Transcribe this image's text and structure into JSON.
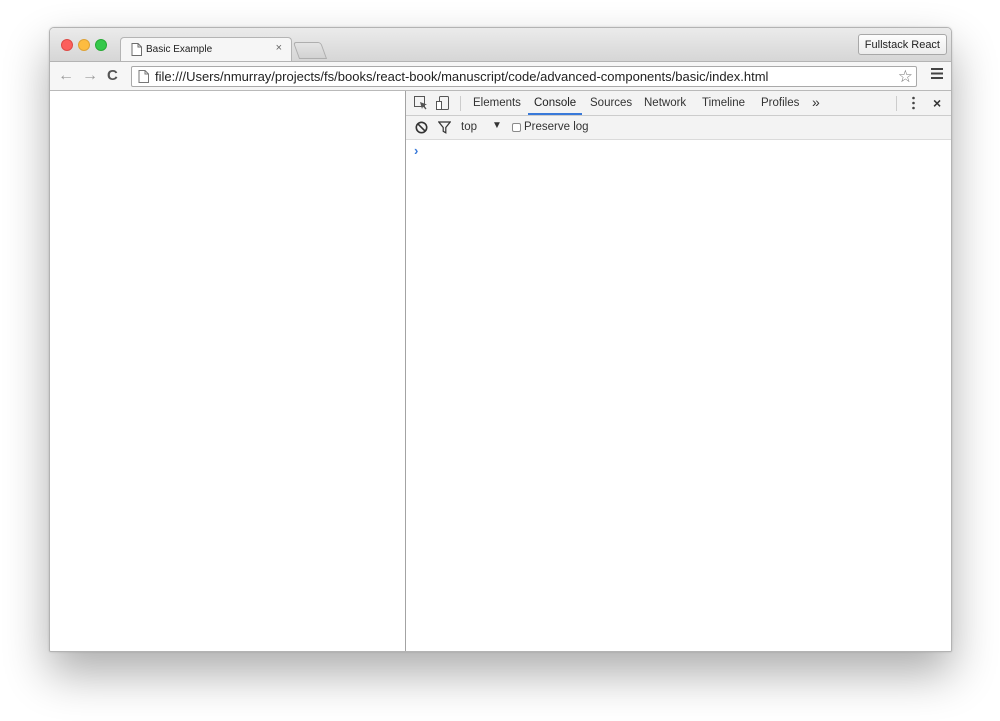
{
  "tab": {
    "title": "Basic Example",
    "close": "×"
  },
  "profile": {
    "label": "Fullstack React"
  },
  "toolbar": {
    "back": "←",
    "forward": "→",
    "reload": "C",
    "url": "file:///Users/nmurray/projects/fs/books/react-book/manuscript/code/advanced-components/basic/index.html",
    "star": "☆"
  },
  "devtools": {
    "tabs": [
      {
        "label": "Elements"
      },
      {
        "label": "Console"
      },
      {
        "label": "Sources"
      },
      {
        "label": "Network"
      },
      {
        "label": "Timeline"
      },
      {
        "label": "Profiles"
      }
    ],
    "active_tab": "Console",
    "more": "»",
    "close": "×",
    "console": {
      "context": "top",
      "context_caret": "▼",
      "preserve_log_label": "Preserve log",
      "preserve_log_checked": false,
      "prompt": "›"
    }
  },
  "icons": {
    "tab_page": "page-icon",
    "omnibox_page": "page-icon",
    "menu": "hamburger-menu-icon",
    "inspect": "inspect-element-icon",
    "device": "device-toolbar-icon",
    "clear": "clear-console-icon",
    "filter": "filter-icon",
    "kebab": "kebab-menu-icon"
  },
  "colors": {
    "accent": "#3879d9",
    "close_red": "#fc605c",
    "minimize_yellow": "#fdbc40",
    "zoom_green": "#34c84a"
  }
}
